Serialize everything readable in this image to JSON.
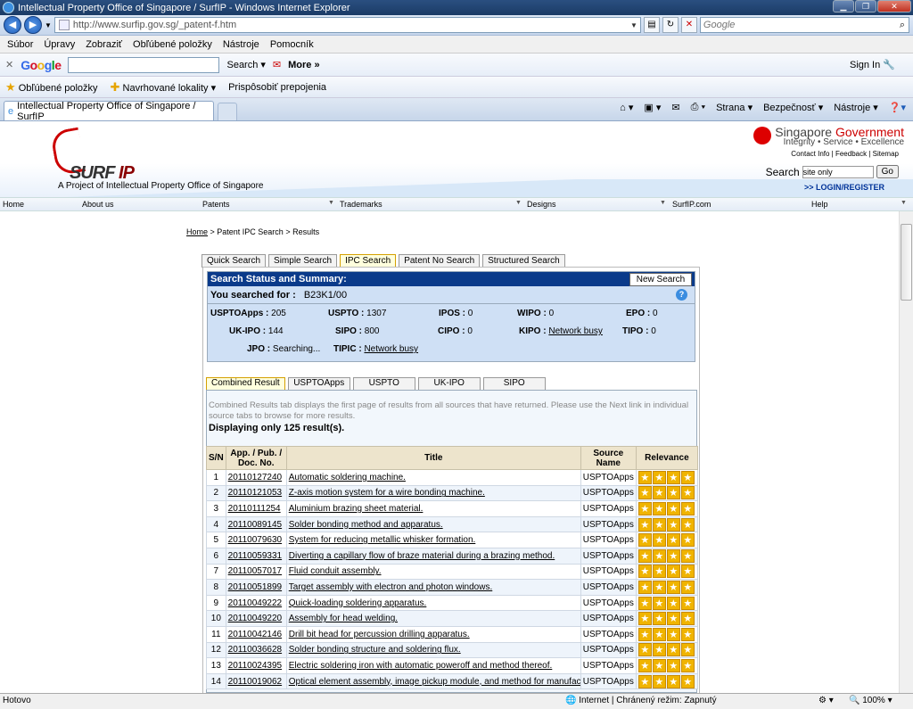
{
  "window": {
    "title": "Intellectual Property Office of Singapore / SurfIP - Windows Internet Explorer"
  },
  "address": {
    "url": "http://www.surfip.gov.sg/_patent-f.htm",
    "search_placeholder": "Google"
  },
  "menu": [
    "Súbor",
    "Úpravy",
    "Zobraziť",
    "Obľúbené položky",
    "Nástroje",
    "Pomocník"
  ],
  "google_toolbar": {
    "logo": "Google",
    "search_label": "Search",
    "more_label": "More",
    "signin_label": "Sign In"
  },
  "favorites": {
    "fav_label": "Obľúbené položky",
    "suggested": "Navrhované lokality",
    "customize": "Prispôsobiť prepojenia"
  },
  "tab": {
    "title": "Intellectual Property Office of Singapore / SurfIP"
  },
  "commands": {
    "page": "Strana",
    "safety": "Bezpečnosť",
    "tools": "Nástroje"
  },
  "site": {
    "logo_text_1": "SURF",
    "logo_text_2": " IP",
    "tagline": "A Project of Intellectual Property Office of Singapore",
    "gov_1": "Singapore ",
    "gov_2": "Government",
    "gov_tag": "Integrity • Service • Excellence",
    "links": [
      "Contact Info",
      "Feedback",
      "Sitemap"
    ],
    "search_label": "Search",
    "search_value": "site only",
    "go": "Go",
    "login": ">> LOGIN/REGISTER",
    "nav": [
      "Home",
      "About us",
      "Patents",
      "Trademarks",
      "Designs",
      "SurfIP.com",
      "Help"
    ]
  },
  "breadcrumb": {
    "home": "Home",
    "rest": " > Patent IPC Search > Results"
  },
  "search_tabs": [
    "Quick Search",
    "Simple Search",
    "IPC Search",
    "Patent No Search",
    "Structured Search"
  ],
  "summary": {
    "heading": "Search Status and Summary:",
    "new_search": "New Search",
    "you_searched_label": "You searched for :",
    "query": "B23K1/00",
    "stats": [
      {
        "k": "USPTOApps :",
        "v": "205"
      },
      {
        "k": "USPTO :",
        "v": "1307"
      },
      {
        "k": "IPOS :",
        "v": "0"
      },
      {
        "k": "WIPO :",
        "v": "0"
      },
      {
        "k": "EPO :",
        "v": "0"
      },
      {
        "k": "UK-IPO :",
        "v": "144"
      },
      {
        "k": "SIPO :",
        "v": "800"
      },
      {
        "k": "CIPO :",
        "v": "0"
      },
      {
        "k": "KIPO :",
        "v": "Network busy"
      },
      {
        "k": "TIPO :",
        "v": "0"
      },
      {
        "k": "JPO :",
        "v": "Searching..."
      },
      {
        "k": "TIPIC :",
        "v": "Network busy"
      }
    ]
  },
  "result_tabs": [
    "Combined Result",
    "USPTOApps",
    "USPTO",
    "UK-IPO",
    "SIPO"
  ],
  "results": {
    "note": "Combined Results tab displays the first page of results from all sources that have returned. Please use the Next link in individual source tabs to browse for more results.",
    "count": "Displaying only 125 result(s).",
    "columns": [
      "S/N",
      "App. / Pub. / Doc. No.",
      "Title",
      "Source Name",
      "Relevance"
    ],
    "rows": [
      [
        "1",
        "20110127240",
        "Automatic soldering machine.",
        "USPTOApps"
      ],
      [
        "2",
        "20110121053",
        "Z-axis motion system for a wire bonding machine.",
        "USPTOApps"
      ],
      [
        "3",
        "20110111254",
        "Aluminium brazing sheet material.",
        "USPTOApps"
      ],
      [
        "4",
        "20110089145",
        "Solder bonding method and apparatus.",
        "USPTOApps"
      ],
      [
        "5",
        "20110079630",
        "System for reducing metallic whisker formation.",
        "USPTOApps"
      ],
      [
        "6",
        "20110059331",
        "Diverting a capillary flow of braze material during a brazing method.",
        "USPTOApps"
      ],
      [
        "7",
        "20110057017",
        "Fluid conduit assembly.",
        "USPTOApps"
      ],
      [
        "8",
        "20110051899",
        "Target assembly with electron and photon windows.",
        "USPTOApps"
      ],
      [
        "9",
        "20110049222",
        "Quick-loading soldering apparatus.",
        "USPTOApps"
      ],
      [
        "10",
        "20110049220",
        "Assembly for head welding.",
        "USPTOApps"
      ],
      [
        "11",
        "20110042146",
        "Drill bit head for percussion drilling apparatus.",
        "USPTOApps"
      ],
      [
        "12",
        "20110036628",
        "Solder bonding structure and soldering flux.",
        "USPTOApps"
      ],
      [
        "13",
        "20110024395",
        "Electric soldering iron with automatic poweroff and method thereof.",
        "USPTOApps"
      ],
      [
        "14",
        "20110019062",
        "Optical element assembly, image pickup module, and method for manufacturing electronic apparatus.",
        "USPTOApps"
      ]
    ],
    "relevance_stars": 4
  },
  "statusbar": {
    "left": "Hotovo",
    "zone": "Internet | Chránený režim: Zapnutý",
    "zoom": "100%"
  }
}
